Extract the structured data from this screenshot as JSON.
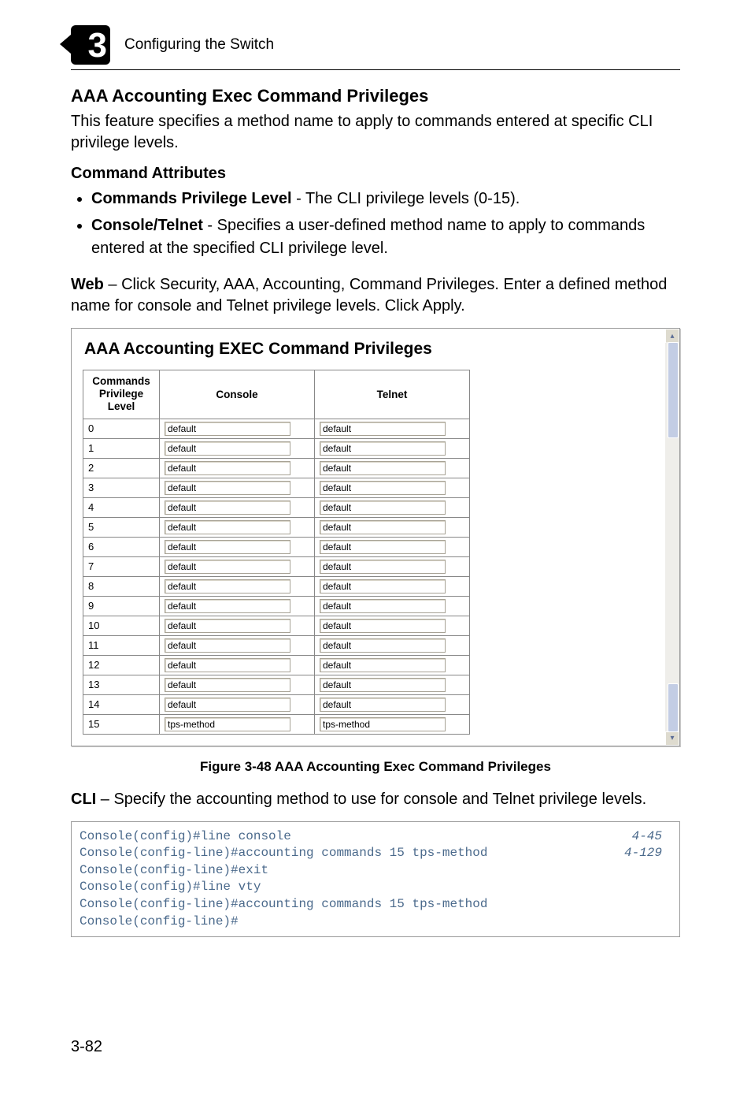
{
  "header": {
    "chapter_number": "3",
    "title": "Configuring the Switch"
  },
  "section": {
    "title": "AAA Accounting Exec Command Privileges",
    "intro": "This feature specifies a method name to apply to commands entered at specific CLI privilege levels."
  },
  "command_attributes": {
    "heading": "Command Attributes",
    "items": [
      {
        "label": "Commands Privilege Level",
        "desc": " - The CLI privilege levels (0-15)."
      },
      {
        "label": "Console/Telnet",
        "desc": " - Specifies a user-defined method name to apply to commands entered at the specified CLI privilege level."
      }
    ]
  },
  "web": {
    "prefix": "Web",
    "text": " – Click Security, AAA, Accounting, Command Privileges. Enter a defined method name for console and Telnet privilege levels. Click Apply."
  },
  "screenshot": {
    "title": "AAA Accounting EXEC Command Privileges",
    "columns": {
      "level": "Commands Privilege Level",
      "console": "Console",
      "telnet": "Telnet"
    },
    "rows": [
      {
        "level": "0",
        "console": "default",
        "telnet": "default"
      },
      {
        "level": "1",
        "console": "default",
        "telnet": "default"
      },
      {
        "level": "2",
        "console": "default",
        "telnet": "default"
      },
      {
        "level": "3",
        "console": "default",
        "telnet": "default"
      },
      {
        "level": "4",
        "console": "default",
        "telnet": "default"
      },
      {
        "level": "5",
        "console": "default",
        "telnet": "default"
      },
      {
        "level": "6",
        "console": "default",
        "telnet": "default"
      },
      {
        "level": "7",
        "console": "default",
        "telnet": "default"
      },
      {
        "level": "8",
        "console": "default",
        "telnet": "default"
      },
      {
        "level": "9",
        "console": "default",
        "telnet": "default"
      },
      {
        "level": "10",
        "console": "default",
        "telnet": "default"
      },
      {
        "level": "11",
        "console": "default",
        "telnet": "default"
      },
      {
        "level": "12",
        "console": "default",
        "telnet": "default"
      },
      {
        "level": "13",
        "console": "default",
        "telnet": "default"
      },
      {
        "level": "14",
        "console": "default",
        "telnet": "default"
      },
      {
        "level": "15",
        "console": "tps-method",
        "telnet": "tps-method"
      }
    ]
  },
  "figure_caption": "Figure 3-48  AAA Accounting Exec Command Privileges",
  "cli": {
    "prefix": "CLI",
    "text": " – Specify the accounting method to use for console and Telnet privilege levels.",
    "lines": [
      {
        "cmd": "Console(config)#line console",
        "ref": "4-45"
      },
      {
        "cmd": "Console(config-line)#accounting commands 15 tps-method",
        "ref": "4-129"
      },
      {
        "cmd": "Console(config-line)#exit",
        "ref": ""
      },
      {
        "cmd": "Console(config)#line vty",
        "ref": ""
      },
      {
        "cmd": "Console(config-line)#accounting commands 15 tps-method",
        "ref": ""
      },
      {
        "cmd": "Console(config-line)#",
        "ref": ""
      }
    ]
  },
  "page_number": "3-82"
}
